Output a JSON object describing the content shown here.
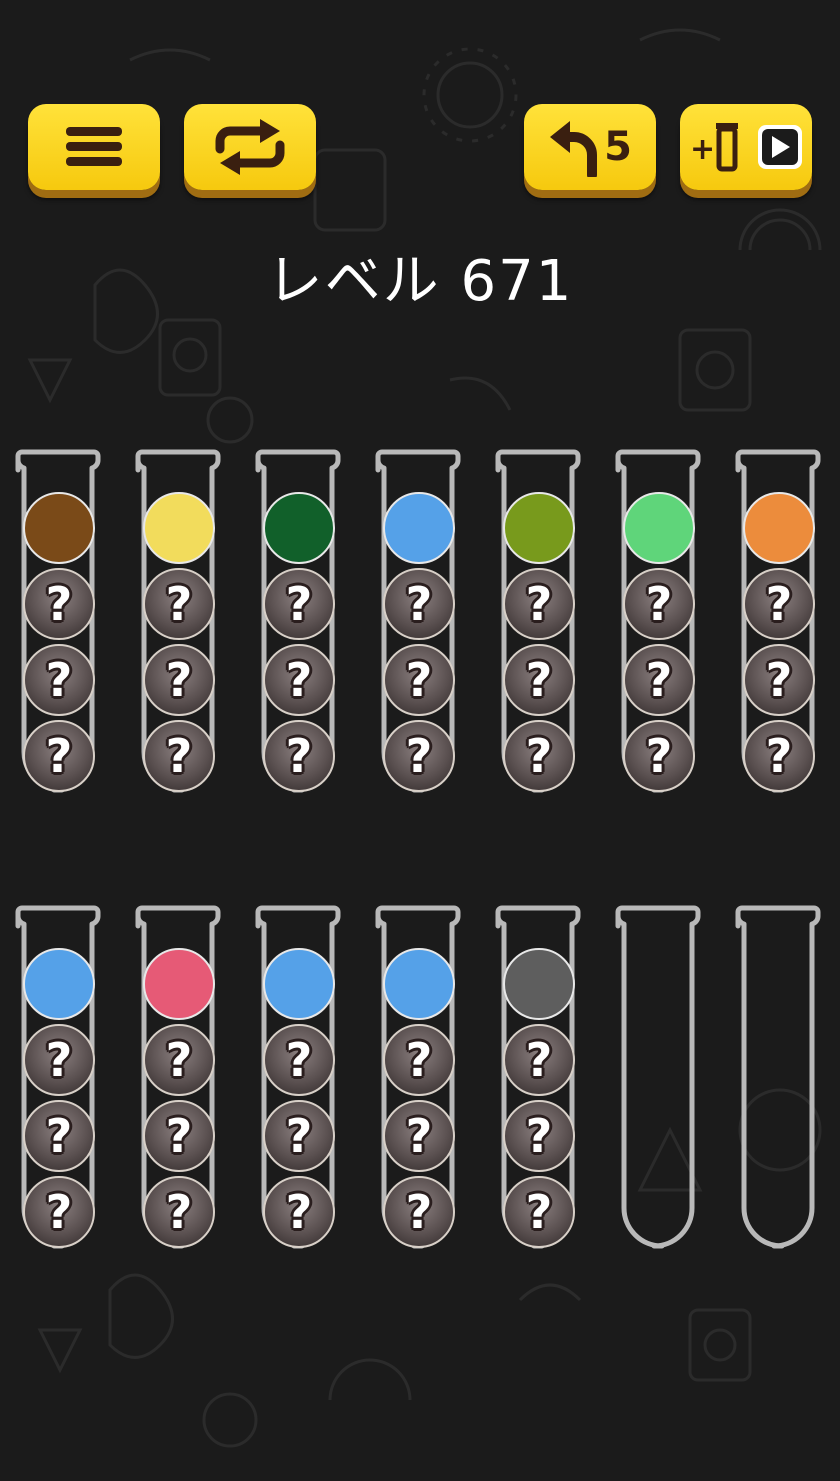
{
  "level": {
    "label": "レベル 671"
  },
  "toolbar": {
    "undo_count": "5"
  },
  "icons": {
    "menu": "hamburger-menu-icon",
    "restart": "restart-arrows-icon",
    "undo": "undo-arrow-icon",
    "add_tube": "add-tube-video-icon"
  },
  "colors": {
    "brown": "#7a4a18",
    "yellow": "#f2dc5c",
    "dark_green": "#11602a",
    "blue": "#55a1e8",
    "olive": "#789a1c",
    "light_green": "#5fd57a",
    "orange": "#ec8c3c",
    "pink": "#e65a76",
    "gray": "#5e5e5e",
    "button_yellow": "#f6c90e",
    "tube_outline": "#b9b9b9"
  },
  "tubes": [
    {
      "balls": [
        "brown",
        "?",
        "?",
        "?"
      ]
    },
    {
      "balls": [
        "yellow",
        "?",
        "?",
        "?"
      ]
    },
    {
      "balls": [
        "dark_green",
        "?",
        "?",
        "?"
      ]
    },
    {
      "balls": [
        "blue",
        "?",
        "?",
        "?"
      ]
    },
    {
      "balls": [
        "olive",
        "?",
        "?",
        "?"
      ]
    },
    {
      "balls": [
        "light_green",
        "?",
        "?",
        "?"
      ]
    },
    {
      "balls": [
        "orange",
        "?",
        "?",
        "?"
      ]
    },
    {
      "balls": [
        "blue",
        "?",
        "?",
        "?"
      ]
    },
    {
      "balls": [
        "pink",
        "?",
        "?",
        "?"
      ]
    },
    {
      "balls": [
        "blue",
        "?",
        "?",
        "?"
      ]
    },
    {
      "balls": [
        "blue",
        "?",
        "?",
        "?"
      ]
    },
    {
      "balls": [
        "gray",
        "?",
        "?",
        "?"
      ]
    },
    {
      "balls": []
    },
    {
      "balls": []
    }
  ],
  "mystery_symbol": "?"
}
